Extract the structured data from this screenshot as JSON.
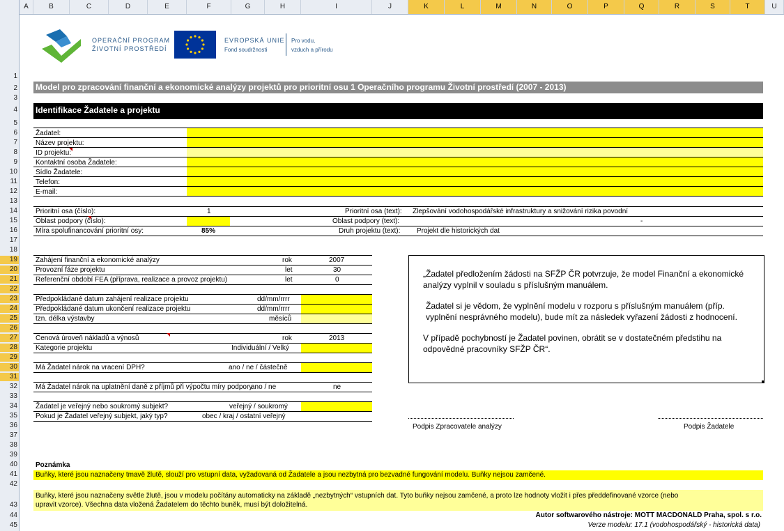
{
  "column_headers": [
    "A",
    "B",
    "C",
    "D",
    "E",
    "F",
    "G",
    "H",
    "I",
    "J",
    "K",
    "L",
    "M",
    "N",
    "O",
    "P",
    "Q",
    "R",
    "S",
    "T",
    "U"
  ],
  "row_headers": [
    "1",
    "2",
    "3",
    "4",
    "5",
    "6",
    "7",
    "8",
    "9",
    "10",
    "11",
    "12",
    "13",
    "14",
    "15",
    "16",
    "17",
    "18",
    "19",
    "20",
    "21",
    "22",
    "23",
    "24",
    "25",
    "26",
    "27",
    "28",
    "29",
    "30",
    "31",
    "32",
    "33",
    "34",
    "35",
    "36",
    "37",
    "38",
    "39",
    "40",
    "41",
    "42",
    "43",
    "44",
    "45"
  ],
  "logo": {
    "op_line1": "OPERAČNÍ PROGRAM",
    "op_line2": "ŽIVOTNÍ PROSTŘEDÍ",
    "eu_line1": "EVROPSKÁ UNIE",
    "eu_line2": "Fond soudržnosti",
    "motto_line1": "Pro vodu,",
    "motto_line2": "vzduch a přírodu"
  },
  "title": "Model pro zpracování finanční a ekonomické analýzy projektů pro prioritní osu 1 Operačního programu Životní prostředí (2007 - 2013)",
  "section_title": "Identifikace Žadatele a projektu",
  "applicant_fields": [
    "Žadatel:",
    "Název projektu:",
    "ID projektu:",
    "Kontaktní osoba Žadatele:",
    "Sídlo Žadatele:",
    "Telefon:",
    "E-mail:"
  ],
  "priority": {
    "axis_num_label": "Prioritní osa (číslo):",
    "axis_num_value": "1",
    "axis_text_label": "Prioritní osa (text):",
    "axis_text_value": "Zlepšování vodohospodářské infrastruktury a snižování rizika povodní",
    "support_num_label": "Oblast podpory (číslo):",
    "support_text_label": "Oblast podpory (text):",
    "support_text_value": "-",
    "cofin_label": "Míra spolufinancování prioritní osy:",
    "cofin_value": "85%",
    "type_label": "Druh projektu (text):",
    "type_value": "Projekt dle historických dat"
  },
  "analysis": {
    "start_label": "Zahájení finanční a ekonomické analýzy",
    "start_unit": "rok",
    "start_value": "2007",
    "ops_label": "Provozní fáze projektu",
    "ops_unit": "let",
    "ops_value": "30",
    "ref_label": "Referenční období FEA (příprava, realizace a provoz projektu)",
    "ref_unit": "let",
    "ref_value": "0",
    "date_start_label": "Předpokládané datum zahájení realizace projektu",
    "date_start_unit": "dd/mm/rrrr",
    "date_end_label": "Předpokládané datum ukončení realizace projektu",
    "date_end_unit": "dd/mm/rrrr",
    "duration_label": "tzn. délka výstavby",
    "duration_unit": "měsíců",
    "price_label": "Cenová úroveň nákladů a výnosů",
    "price_unit": "rok",
    "price_value": "2013",
    "category_label": "Kategorie projektu",
    "category_unit": "Individuální / Velký",
    "vat_label": "Má Žadatel nárok na vracení DPH?",
    "vat_unit": "ano / ne / částečně",
    "tax_label": "Má Žadatel nárok na uplatnění daně z příjmů při výpočtu míry podpory",
    "tax_unit": "ano / ne",
    "tax_value": "ne",
    "public_label": "Žadatel je veřejný nebo soukromý subjekt?",
    "public_unit": "veřejný / soukromý",
    "ptype_label": "Pokud je Žadatel veřejný subjekt, jaký typ?",
    "ptype_unit": "obec / kraj / ostatní veřejný"
  },
  "declaration": {
    "p1": "„Žadatel předložením žádosti na SFŽP ČR potvrzuje, že model Finanční a ekonomické analýzy vyplnil v souladu s příslušným manuálem.",
    "p2": "Žadatel si je vědom, že vyplnění modelu v rozporu s příslušným manuálem (příp. vyplnění nesprávného modelu), bude mít za následek vyřazení žádosti z hodnocení.",
    "p3": "V případě pochybností je Žadatel povinen, obrátit se v dostatečném předstihu na odpovědné pracovníky SFŽP ČR“."
  },
  "signatures": {
    "analyst": "Podpis Zpracovatele analýzy",
    "applicant": "Podpis Žadatele"
  },
  "notes": {
    "heading": "Poznámka",
    "dark_yellow": "Buňky, které jsou naznačeny tmavě žlutě, slouží pro vstupní data, vyžadovaná od Žadatele a jsou nezbytná pro bezvadné fungování modelu. Buňky nejsou zamčené.",
    "light_yellow_1": "Buňky, které jsou naznačeny světle žlutě, jsou v modelu počítány automaticky na základě „nezbytných“ vstupních dat. Tyto buňky nejsou zamčené, a proto lze hodnoty vložit i přes předdefinované vzorce (nebo",
    "light_yellow_2": "upravit vzorce). Všechna data vložená Žadatelem do těchto buněk, musí být doložitelná."
  },
  "footer": {
    "author": "Autor softwarového nástroje: MOTT MACDONALD Praha, spol. s r.o.",
    "version": "Verze modelu: 17.1 (vodohospodářský - historická data)"
  },
  "colors": {
    "input_yellow": "#ffff00",
    "calc_yellow": "#ffff99",
    "title_gray": "#8c8c8c",
    "section_black": "#000000"
  }
}
